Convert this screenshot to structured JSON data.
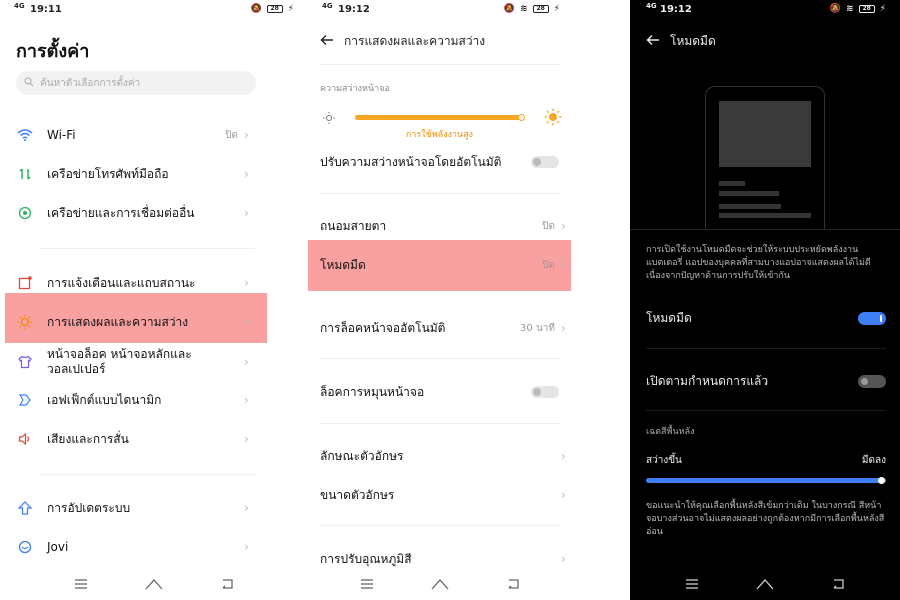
{
  "screen1": {
    "status": {
      "signal": "4G",
      "time": "19:11",
      "battery": "28"
    },
    "title": "การตั้งค่า",
    "search_placeholder": "ค้นหาตัวเลือกการตั้งค่า",
    "items": [
      {
        "label": "Wi-Fi",
        "value": "ปิด",
        "icon": "wifi-icon"
      },
      {
        "label": "เครือข่ายโทรศัพท์มือถือ",
        "value": "",
        "icon": "mobile-data-icon"
      },
      {
        "label": "เครือข่ายและการเชื่อมต่ออื่น",
        "value": "",
        "icon": "connection-icon"
      },
      {
        "label": "การแจ้งเตือนและแถบสถานะ",
        "value": "",
        "icon": "notification-icon"
      },
      {
        "label": "การแสดงผลและความสว่าง",
        "value": "",
        "icon": "brightness-icon"
      },
      {
        "label": "หน้าจอล็อค หน้าจอหลักและวอลเปเปอร์",
        "value": "",
        "icon": "shirt-icon"
      },
      {
        "label": "เอฟเฟ็กต์แบบไดนามิก",
        "value": "",
        "icon": "dynamic-effects-icon"
      },
      {
        "label": "เสียงและการสั่น",
        "value": "",
        "icon": "sound-icon"
      },
      {
        "label": "การอัปเดตระบบ",
        "value": "",
        "icon": "update-icon"
      },
      {
        "label": "Jovi",
        "value": "",
        "icon": "jovi-icon"
      }
    ]
  },
  "screen2": {
    "status": {
      "signal": "4G",
      "time": "19:12",
      "battery": "28"
    },
    "title": "การแสดงผลและความสว่าง",
    "brightness_section": "ความสว่างหน้าจอ",
    "brightness_level": 0.98,
    "brightness_hint": "การใช้พลังงานสูง",
    "items": [
      {
        "label": "ปรับความสว่างหน้าจอโดยอัตโนมัติ",
        "value": "",
        "control": "toggle-off"
      },
      {
        "label": "ถนอมสายตา",
        "value": "ปิด",
        "control": "chevron"
      },
      {
        "label": "โหมดมืด",
        "value": "ปิด",
        "control": "chevron"
      },
      {
        "label": "การล็อคหน้าจออัตโนมัติ",
        "value": "30 นาที",
        "control": "chevron"
      },
      {
        "label": "ล็อคการหมุนหน้าจอ",
        "value": "",
        "control": "toggle-off"
      },
      {
        "label": "ลักษณะตัวอักษร",
        "value": "",
        "control": "chevron"
      },
      {
        "label": "ขนาดตัวอักษร",
        "value": "",
        "control": "chevron"
      },
      {
        "label": "การปรับอุณหภูมิสี",
        "value": "",
        "control": "chevron"
      }
    ]
  },
  "screen3": {
    "status": {
      "signal": "4G",
      "time": "19:12",
      "battery": "28"
    },
    "title": "โหมดมืด",
    "description": "การเปิดใช้งานโหมดมืดจะช่วยให้ระบบประหยัดพลังงานแบตเตอรี่ แอปของบุคคลที่สามบางแอปอาจแสดงผลได้ไม่ดีเนื่องจากปัญหาด้านการปรับให้เข้ากัน",
    "dark_mode_label": "โหมดมืด",
    "dark_mode_on": true,
    "schedule_label": "เปิดตามกำหนดการแล้ว",
    "schedule_on": false,
    "bg_section": "เฉดสีพื้นหลัง",
    "bg_lighter": "สว่างขึ้น",
    "bg_darker": "มืดลง",
    "bg_level": 1.0,
    "note": "ขอแนะนำให้คุณเลือกพื้นหลังสีเข้มกว่าเดิม ในบางกรณี สีหน้าจอบางส่วนอาจไม่แสดงผลอย่างถูกต้องหากมีการเลือกพื้นหลังสีอ่อน"
  },
  "colors": {
    "highlight": "#f9a0a0",
    "accent_orange": "#f5a623",
    "accent_blue": "#3d7ff5"
  }
}
